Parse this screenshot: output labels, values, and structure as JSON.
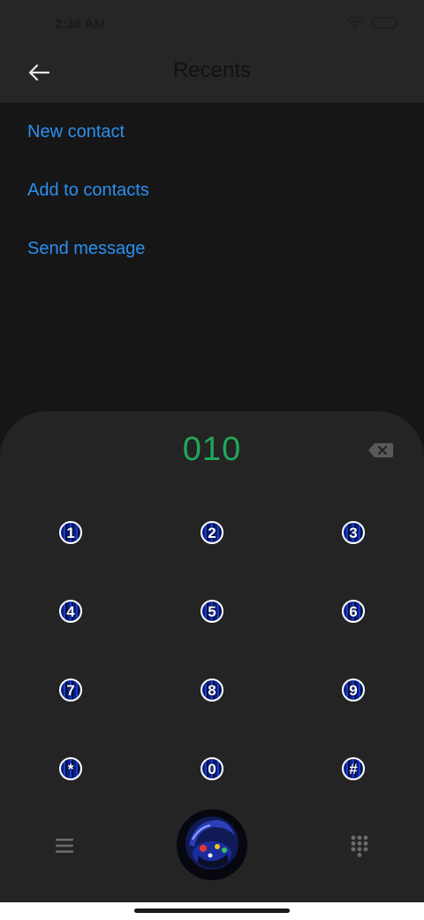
{
  "status_bar": {
    "time": "2:36 AM"
  },
  "header": {
    "title": "Recents",
    "back_icon": "arrow-left-icon"
  },
  "actions": [
    {
      "label": "New contact"
    },
    {
      "label": "Add to contacts"
    },
    {
      "label": "Send message"
    }
  ],
  "dialer": {
    "number": "010",
    "backspace_icon": "backspace-icon",
    "keys": [
      "1",
      "2",
      "3",
      "4",
      "5",
      "6",
      "7",
      "8",
      "9",
      "*",
      "0",
      "#"
    ]
  },
  "bottom_bar": {
    "menu_icon": "hamburger-menu-icon",
    "call_icon": "call-button-image",
    "dialpad_icon": "dialpad-grid-icon"
  },
  "colors": {
    "accent_link": "#2b8ff0",
    "number_green": "#1fa85a",
    "sheet_bg": "#242424",
    "header_bg": "#262626",
    "page_bg": "#161616"
  }
}
